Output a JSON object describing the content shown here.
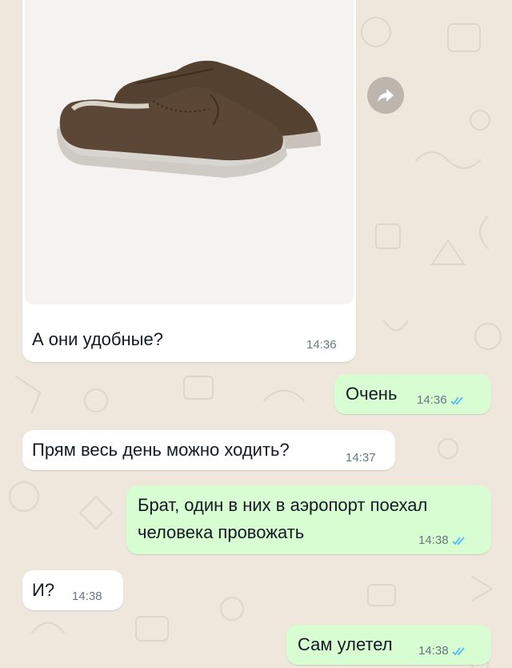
{
  "colors": {
    "wallpaper": "#efe7dc",
    "incoming_bubble": "#ffffff",
    "outgoing_bubble": "#d9fdd3",
    "read_ticks": "#53bdeb",
    "timestamp": "#667781"
  },
  "icons": {
    "forward": "forward-arrow-icon",
    "read_receipt": "double-check-icon"
  },
  "messages": [
    {
      "direction": "in",
      "type": "image",
      "media": "brown suede slide loafer photo",
      "text": "А они удобные?",
      "time": "14:36"
    },
    {
      "direction": "out",
      "text": "Очень",
      "time": "14:36",
      "status": "read"
    },
    {
      "direction": "in",
      "text": "Прям весь день можно ходить?",
      "time": "14:37"
    },
    {
      "direction": "out",
      "lines": [
        "Брат, один в них в аэропорт поехал",
        "человека провожать"
      ],
      "time": "14:38",
      "status": "read"
    },
    {
      "direction": "in",
      "text": "И?",
      "time": "14:38"
    },
    {
      "direction": "out",
      "text": "Сам улетел",
      "time": "14:38",
      "status": "read"
    }
  ]
}
